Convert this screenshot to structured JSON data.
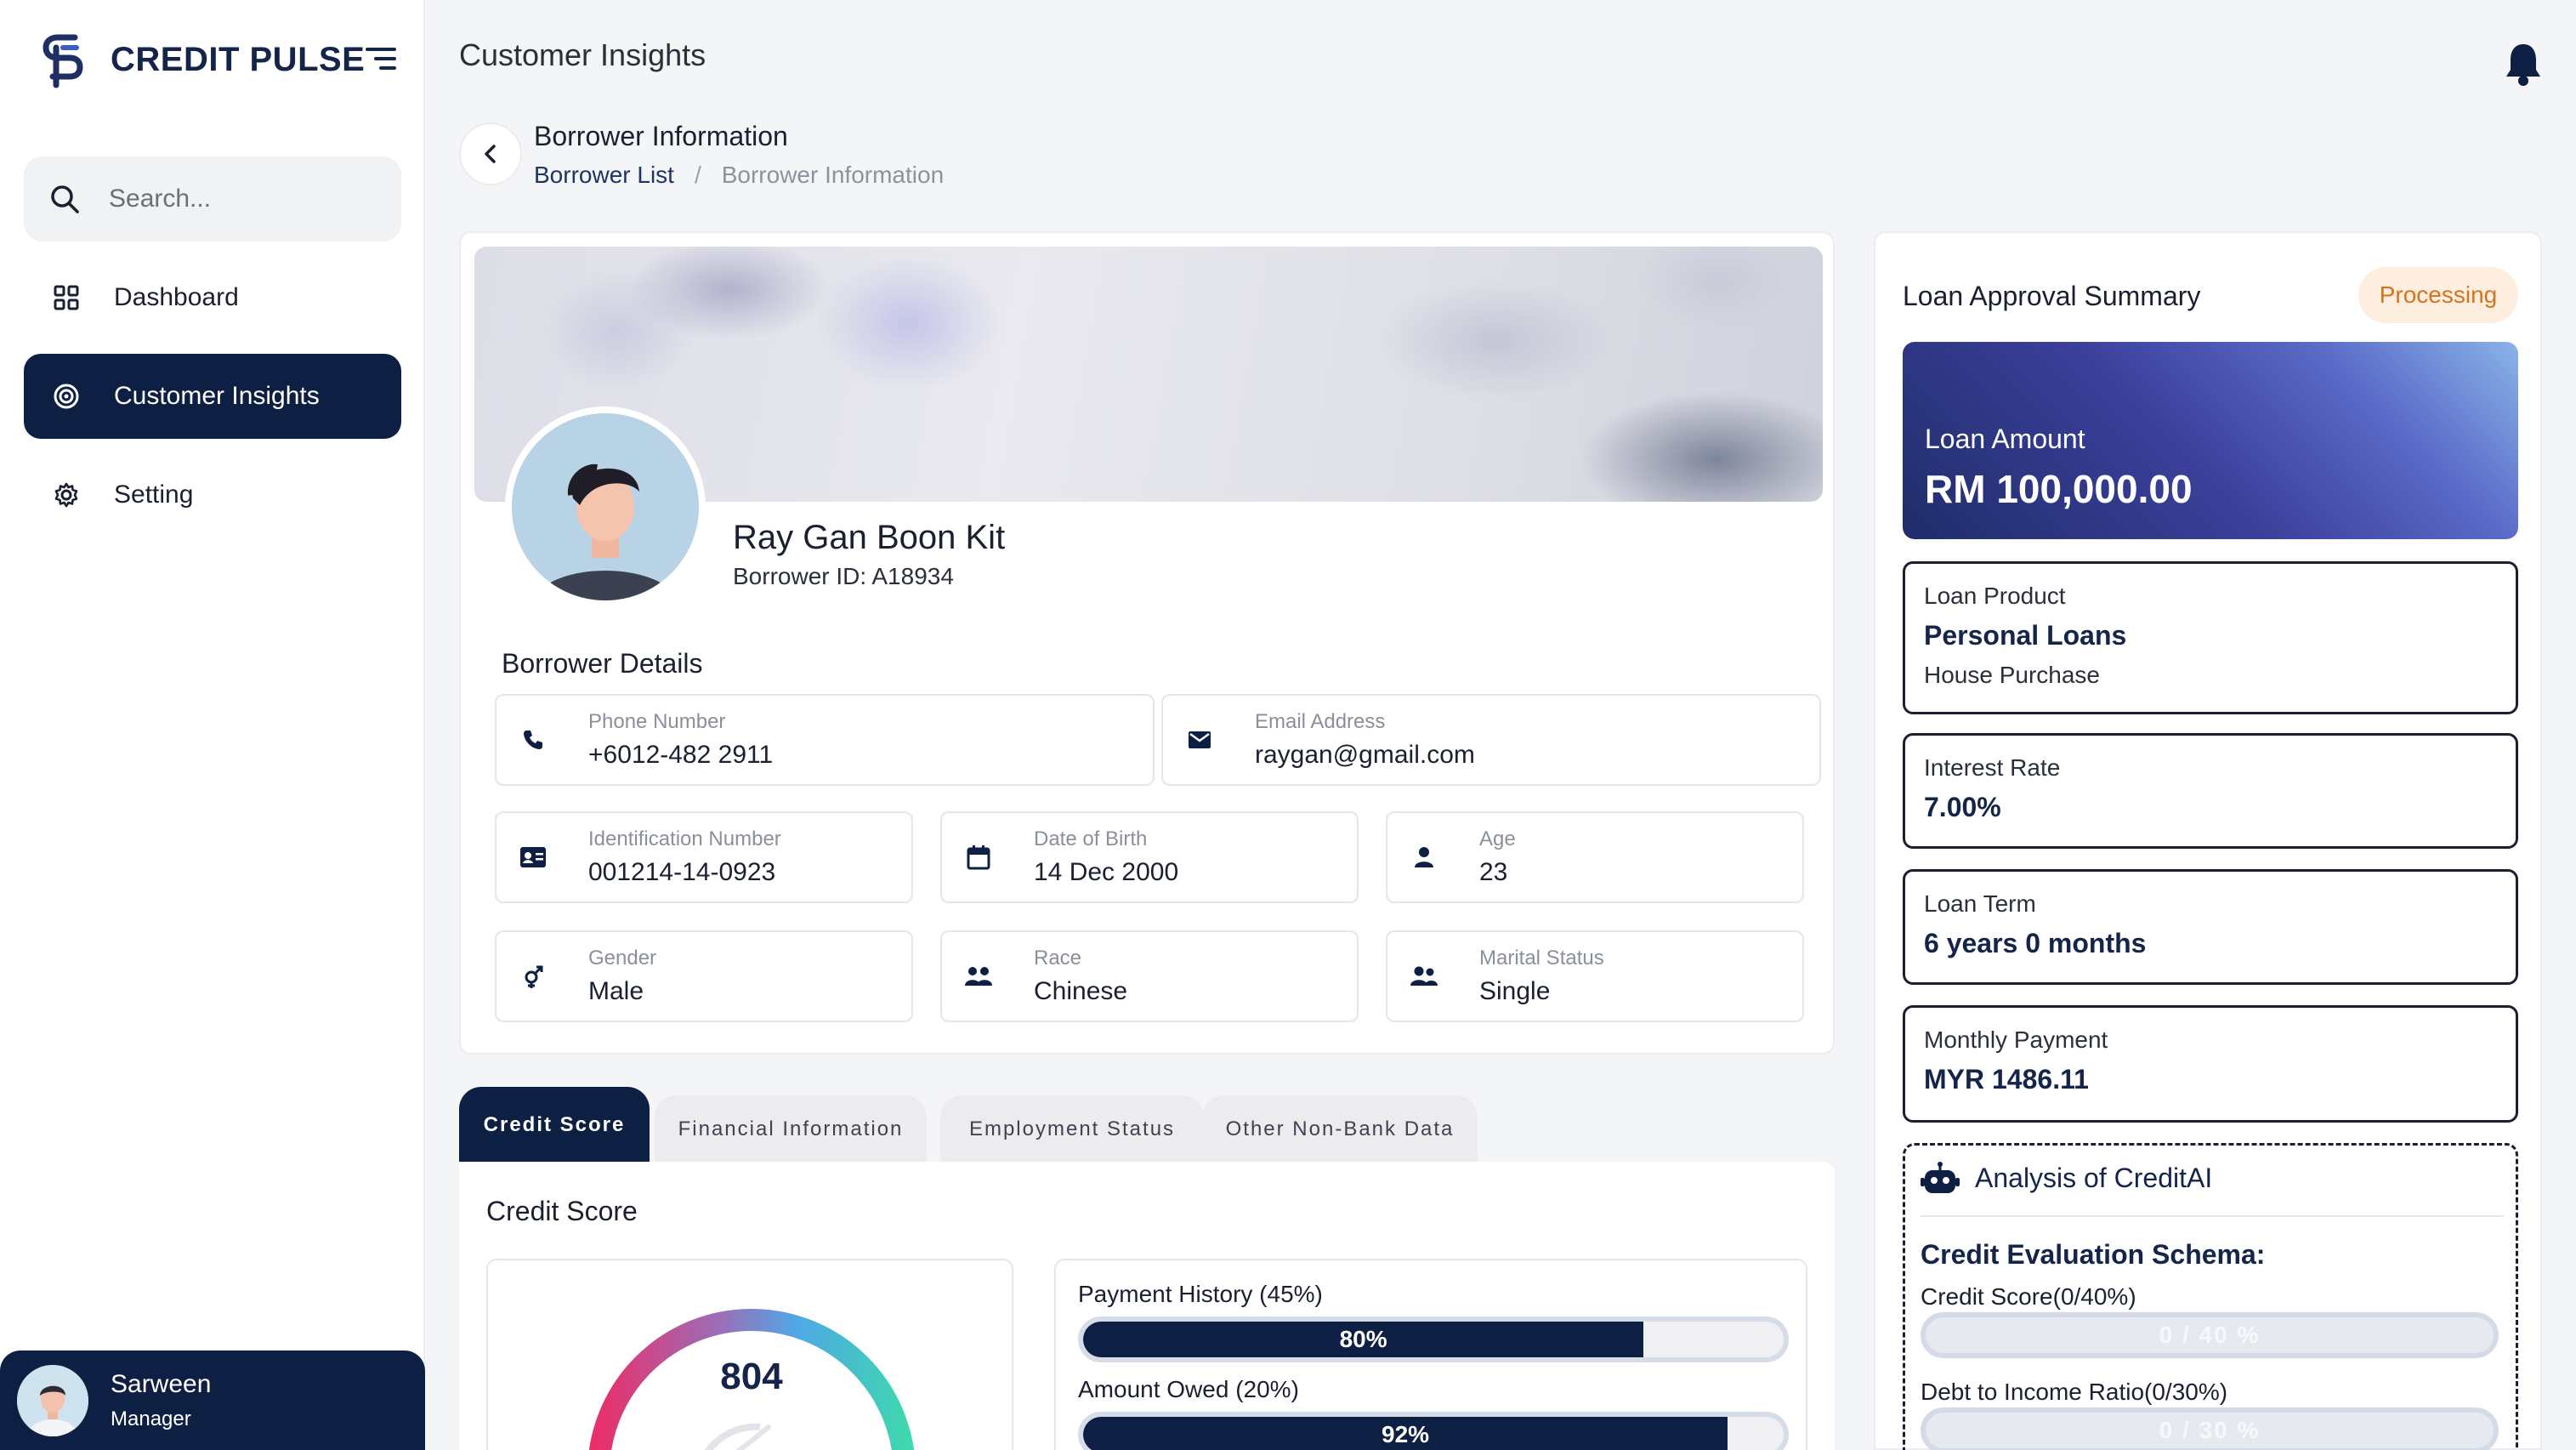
{
  "app": {
    "name": "CREDIT PULSE"
  },
  "search": {
    "placeholder": "Search..."
  },
  "sidebar": {
    "items": [
      {
        "label": "Dashboard",
        "icon": "grid-icon",
        "active": false
      },
      {
        "label": "Customer Insights",
        "icon": "target-icon",
        "active": true
      },
      {
        "label": "Setting",
        "icon": "gear-icon",
        "active": false
      }
    ]
  },
  "user": {
    "name": "Sarween",
    "role": "Manager"
  },
  "header": {
    "title": "Customer Insights"
  },
  "breadcrumb": {
    "title": "Borrower Information",
    "items": [
      "Borrower List",
      "Borrower Information"
    ]
  },
  "borrower": {
    "name": "Ray Gan Boon Kit",
    "id_label": "Borrower ID: A18934",
    "details_title": "Borrower Details",
    "fields": {
      "phone": {
        "label": "Phone Number",
        "value": "+6012-482 2911"
      },
      "email": {
        "label": "Email Address",
        "value": "raygan@gmail.com"
      },
      "ic": {
        "label": "Identification Number",
        "value": "001214-14-0923"
      },
      "dob": {
        "label": "Date of Birth",
        "value": "14 Dec 2000"
      },
      "age": {
        "label": "Age",
        "value": "23"
      },
      "gender": {
        "label": "Gender",
        "value": "Male"
      },
      "race": {
        "label": "Race",
        "value": "Chinese"
      },
      "marital": {
        "label": "Marital Status",
        "value": "Single"
      }
    }
  },
  "tabs": [
    "Credit Score",
    "Financial Information",
    "Employment Status",
    "Other Non-Bank Data"
  ],
  "credit": {
    "title": "Credit Score",
    "score": "804",
    "bars": [
      {
        "label": "Payment History (45%)",
        "percent": 80,
        "text": "80%"
      },
      {
        "label": "Amount Owed (20%)",
        "percent": 92,
        "text": "92%"
      }
    ]
  },
  "loan": {
    "summary_title": "Loan Approval Summary",
    "status": "Processing",
    "amount_label": "Loan Amount",
    "amount": "RM 100,000.00",
    "product_label": "Loan Product",
    "product": "Personal Loans",
    "product_sub": "House Purchase",
    "interest_label": "Interest Rate",
    "interest": "7.00%",
    "term_label": "Loan Term",
    "term": "6 years 0 months",
    "monthly_label": "Monthly Payment",
    "monthly": "MYR 1486.11"
  },
  "ai": {
    "title": "Analysis of CreditAI",
    "schema_title": "Credit Evaluation Schema:",
    "items": [
      {
        "label": "Credit Score(0/40%)",
        "bar_text": "0 / 40 %"
      },
      {
        "label": "Debt to Income Ratio(0/30%)",
        "bar_text": "0 / 30 %"
      }
    ]
  },
  "colors": {
    "navy": "#0e1f44",
    "badge_bg": "#fdeee0",
    "badge_text": "#d7731e"
  }
}
